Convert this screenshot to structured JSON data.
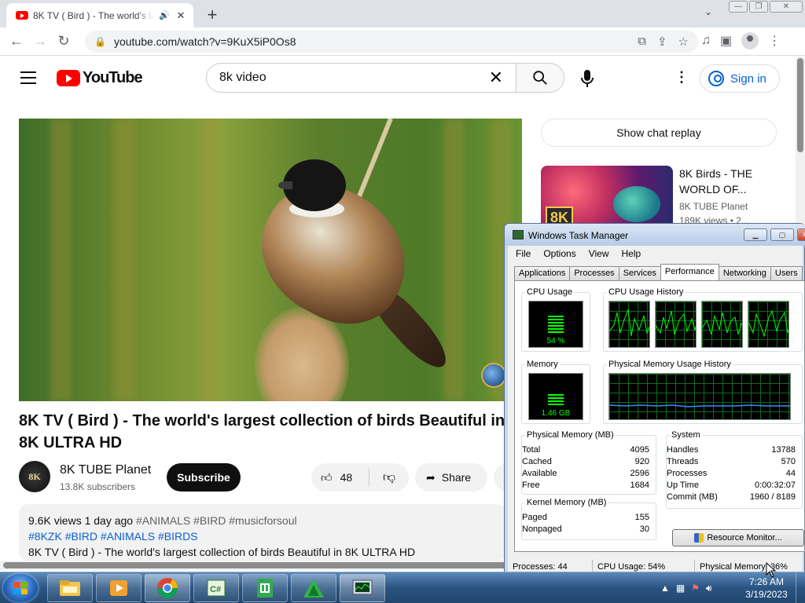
{
  "browser": {
    "tab_title": "8K TV ( Bird ) - The world's la",
    "new_tab": "+",
    "tab_close": "✕",
    "url": "youtube.com/watch?v=9KuX5iP0Os8",
    "window_controls": [
      "—",
      "❐",
      "✕"
    ]
  },
  "youtube": {
    "logo_text": "YouTube",
    "search_query": "8k video",
    "sign_in": "Sign in",
    "video": {
      "title": "8K TV ( Bird ) - The world's largest collection of birds Beautiful in 8K ULTRA HD",
      "channel_avatar_text": "8K",
      "channel_name": "8K TUBE Planet",
      "subscribers": "13.8K subscribers",
      "subscribe_label": "Subscribe",
      "likes": "48",
      "share_label": "Share"
    },
    "description": {
      "meta": "9.6K views  1 day ago",
      "tags_line1": "#ANIMALS #BIRD #musicforsoul",
      "tags_line2": "#8KZK #BIRD #ANIMALS #BIRDS",
      "text": "8K TV ( Bird ) - The world's largest collection of birds Beautiful in 8K ULTRA HD"
    },
    "chat_replay": "Show chat replay",
    "recommended": {
      "badge": "8K",
      "title": "8K Birds - THE WORLD OF...",
      "channel": "8K TUBE Planet",
      "views": "189K views • 2..."
    }
  },
  "task_manager": {
    "title": "Windows Task Manager",
    "menu": [
      "File",
      "Options",
      "View",
      "Help"
    ],
    "tabs": [
      "Applications",
      "Processes",
      "Services",
      "Performance",
      "Networking",
      "Users"
    ],
    "active_tab": "Performance",
    "cpu_usage_label": "CPU Usage",
    "cpu_usage_value": "54 %",
    "cpu_usage_fraction": 0.54,
    "cpu_history_label": "CPU Usage History",
    "memory_label": "Memory",
    "memory_value": "1.46 GB",
    "memory_fraction": 0.36,
    "memory_history_label": "Physical Memory Usage History",
    "physical_memory": {
      "heading": "Physical Memory (MB)",
      "rows": [
        {
          "label": "Total",
          "value": "4095"
        },
        {
          "label": "Cached",
          "value": "920"
        },
        {
          "label": "Available",
          "value": "2596"
        },
        {
          "label": "Free",
          "value": "1684"
        }
      ]
    },
    "kernel_memory": {
      "heading": "Kernel Memory (MB)",
      "rows": [
        {
          "label": "Paged",
          "value": "155"
        },
        {
          "label": "Nonpaged",
          "value": "30"
        }
      ]
    },
    "system": {
      "heading": "System",
      "rows": [
        {
          "label": "Handles",
          "value": "13788"
        },
        {
          "label": "Threads",
          "value": "570"
        },
        {
          "label": "Processes",
          "value": "44"
        },
        {
          "label": "Up Time",
          "value": "0:00:32:07"
        },
        {
          "label": "Commit (MB)",
          "value": "1960 / 8189"
        }
      ]
    },
    "resource_monitor": "Resource Monitor...",
    "status": {
      "processes": "Processes: 44",
      "cpu": "CPU Usage: 54%",
      "memory": "Physical Memory: 36%"
    }
  },
  "taskbar": {
    "time": "7:26 AM",
    "date": "3/19/2023"
  }
}
